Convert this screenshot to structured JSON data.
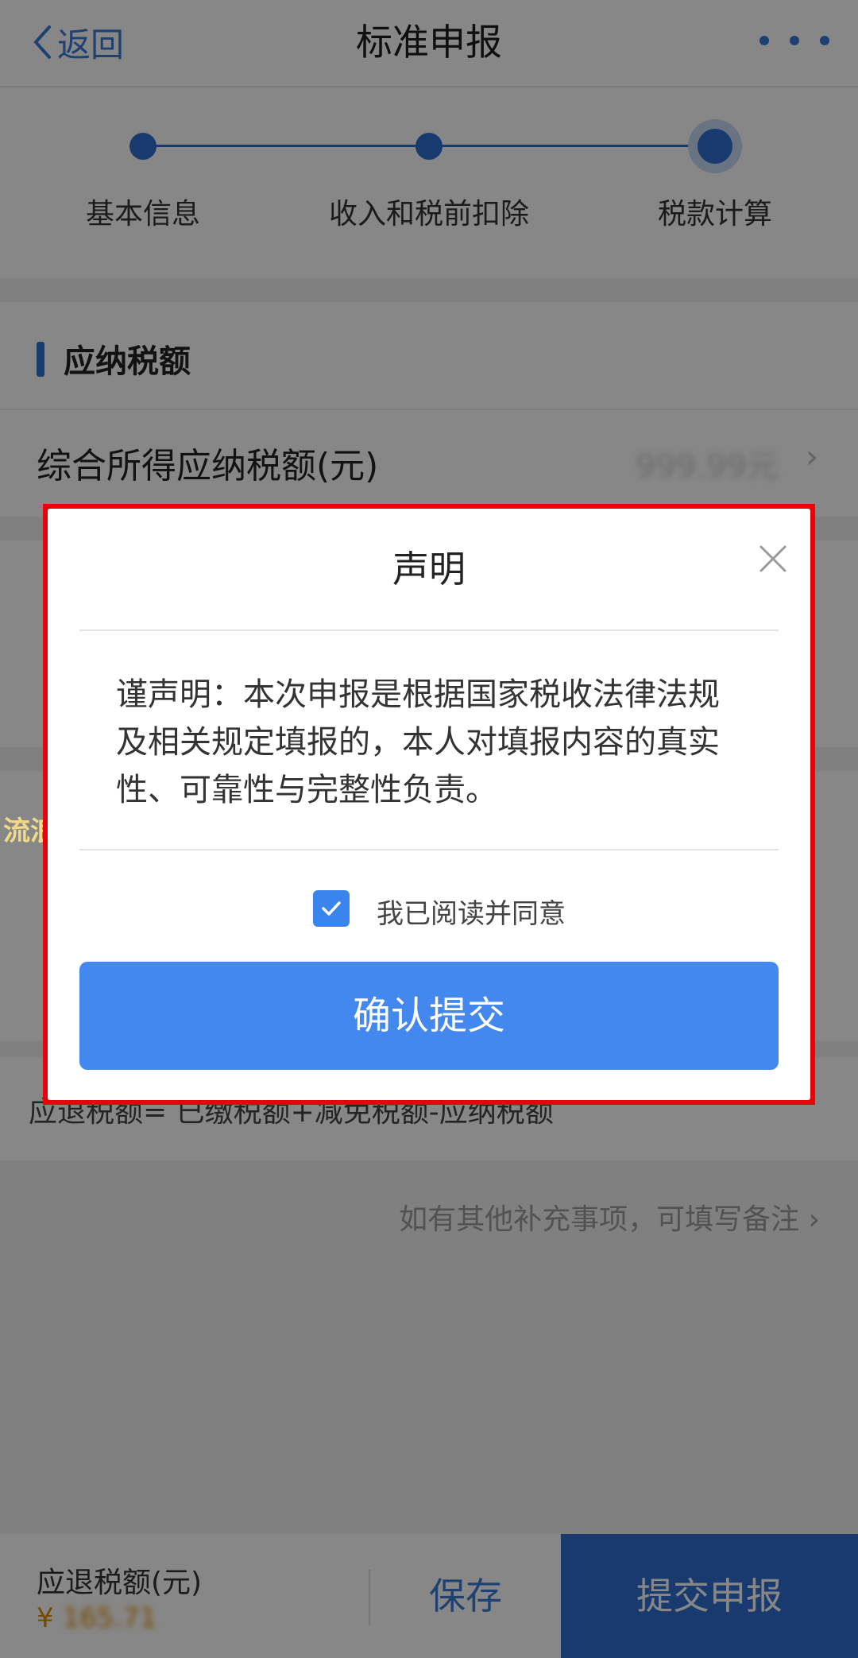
{
  "header": {
    "back_label": "返回",
    "title": "标准申报"
  },
  "stepper": {
    "steps": [
      "基本信息",
      "收入和税前扣除",
      "税款计算"
    ],
    "active_index": 2
  },
  "section": {
    "title": "应纳税额"
  },
  "rows": {
    "tax_payable_label": "综合所得应纳税额(元)",
    "tax_payable_value": "999.99元"
  },
  "formula": "应退税额= 已缴税额+减免税额-应纳税额",
  "note": "如有其他补充事项，可填写备注",
  "watermark": "流浪者",
  "modal": {
    "title": "声明",
    "body": "谨声明：本次申报是根据国家税收法律法规及相关规定填报的，本人对填报内容的真实性、可靠性与完整性负责。",
    "checkbox_label": "我已阅读并同意",
    "checkbox_checked": true,
    "confirm_label": "确认提交"
  },
  "bottom": {
    "refund_label": "应退税额(元)",
    "currency": "¥",
    "amount": "165.71",
    "save_label": "保存",
    "submit_label": "提交申报"
  },
  "colors": {
    "accent": "#2f6fd1",
    "button": "#4288ef",
    "highlight_frame": "#e8000b"
  }
}
